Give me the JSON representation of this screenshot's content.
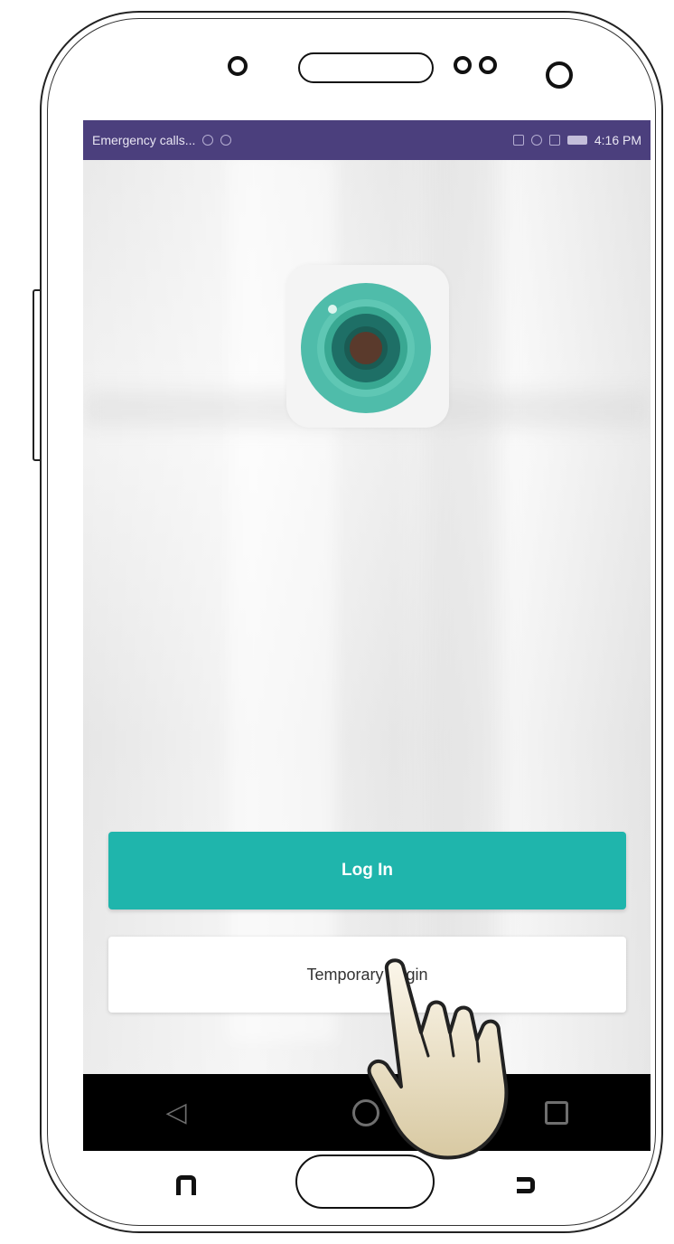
{
  "status_bar": {
    "carrier_text": "Emergency calls...",
    "time": "4:16 PM",
    "bg_color": "#4b3f7d"
  },
  "app": {
    "logo_icon": "camera-lens-icon",
    "brand_color": "#1fb5ac"
  },
  "buttons": {
    "login_label": "Log In",
    "temporary_login_label": "Temporary Login"
  },
  "nav": {
    "back_icon": "triangle-back-icon",
    "home_icon": "circle-home-icon",
    "recent_icon": "square-recent-icon"
  },
  "overlay": {
    "pointer_icon": "hand-pointer-icon"
  }
}
